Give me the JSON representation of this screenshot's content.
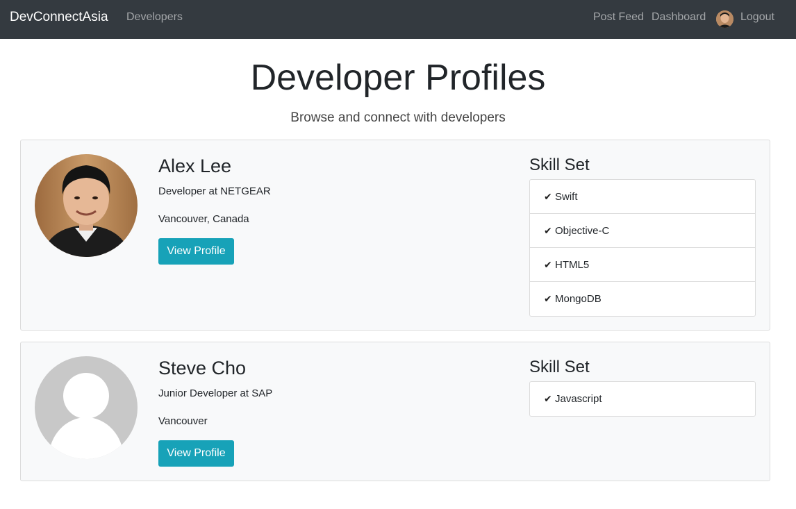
{
  "navbar": {
    "brand": "DevConnectAsia",
    "links": {
      "developers": "Developers",
      "post_feed": "Post Feed",
      "dashboard": "Dashboard",
      "logout": "Logout"
    }
  },
  "header": {
    "title": "Developer Profiles",
    "subtitle": "Browse and connect with developers"
  },
  "profiles": [
    {
      "name": "Alex Lee",
      "status": "Developer at NETGEAR",
      "location": "Vancouver, Canada",
      "button_label": "View Profile",
      "skills_heading": "Skill Set",
      "skills": [
        "Swift",
        "Objective-C",
        "HTML5",
        "MongoDB"
      ]
    },
    {
      "name": "Steve Cho",
      "status": "Junior Developer at SAP",
      "location": "Vancouver",
      "button_label": "View Profile",
      "skills_heading": "Skill Set",
      "skills": [
        "Javascript"
      ]
    }
  ],
  "icons": {
    "check": "check-icon",
    "avatar_default": "default-user-icon"
  },
  "colors": {
    "navbar_bg": "#343a40",
    "button_bg": "#17a2b8",
    "card_bg": "#f8f9fa"
  }
}
